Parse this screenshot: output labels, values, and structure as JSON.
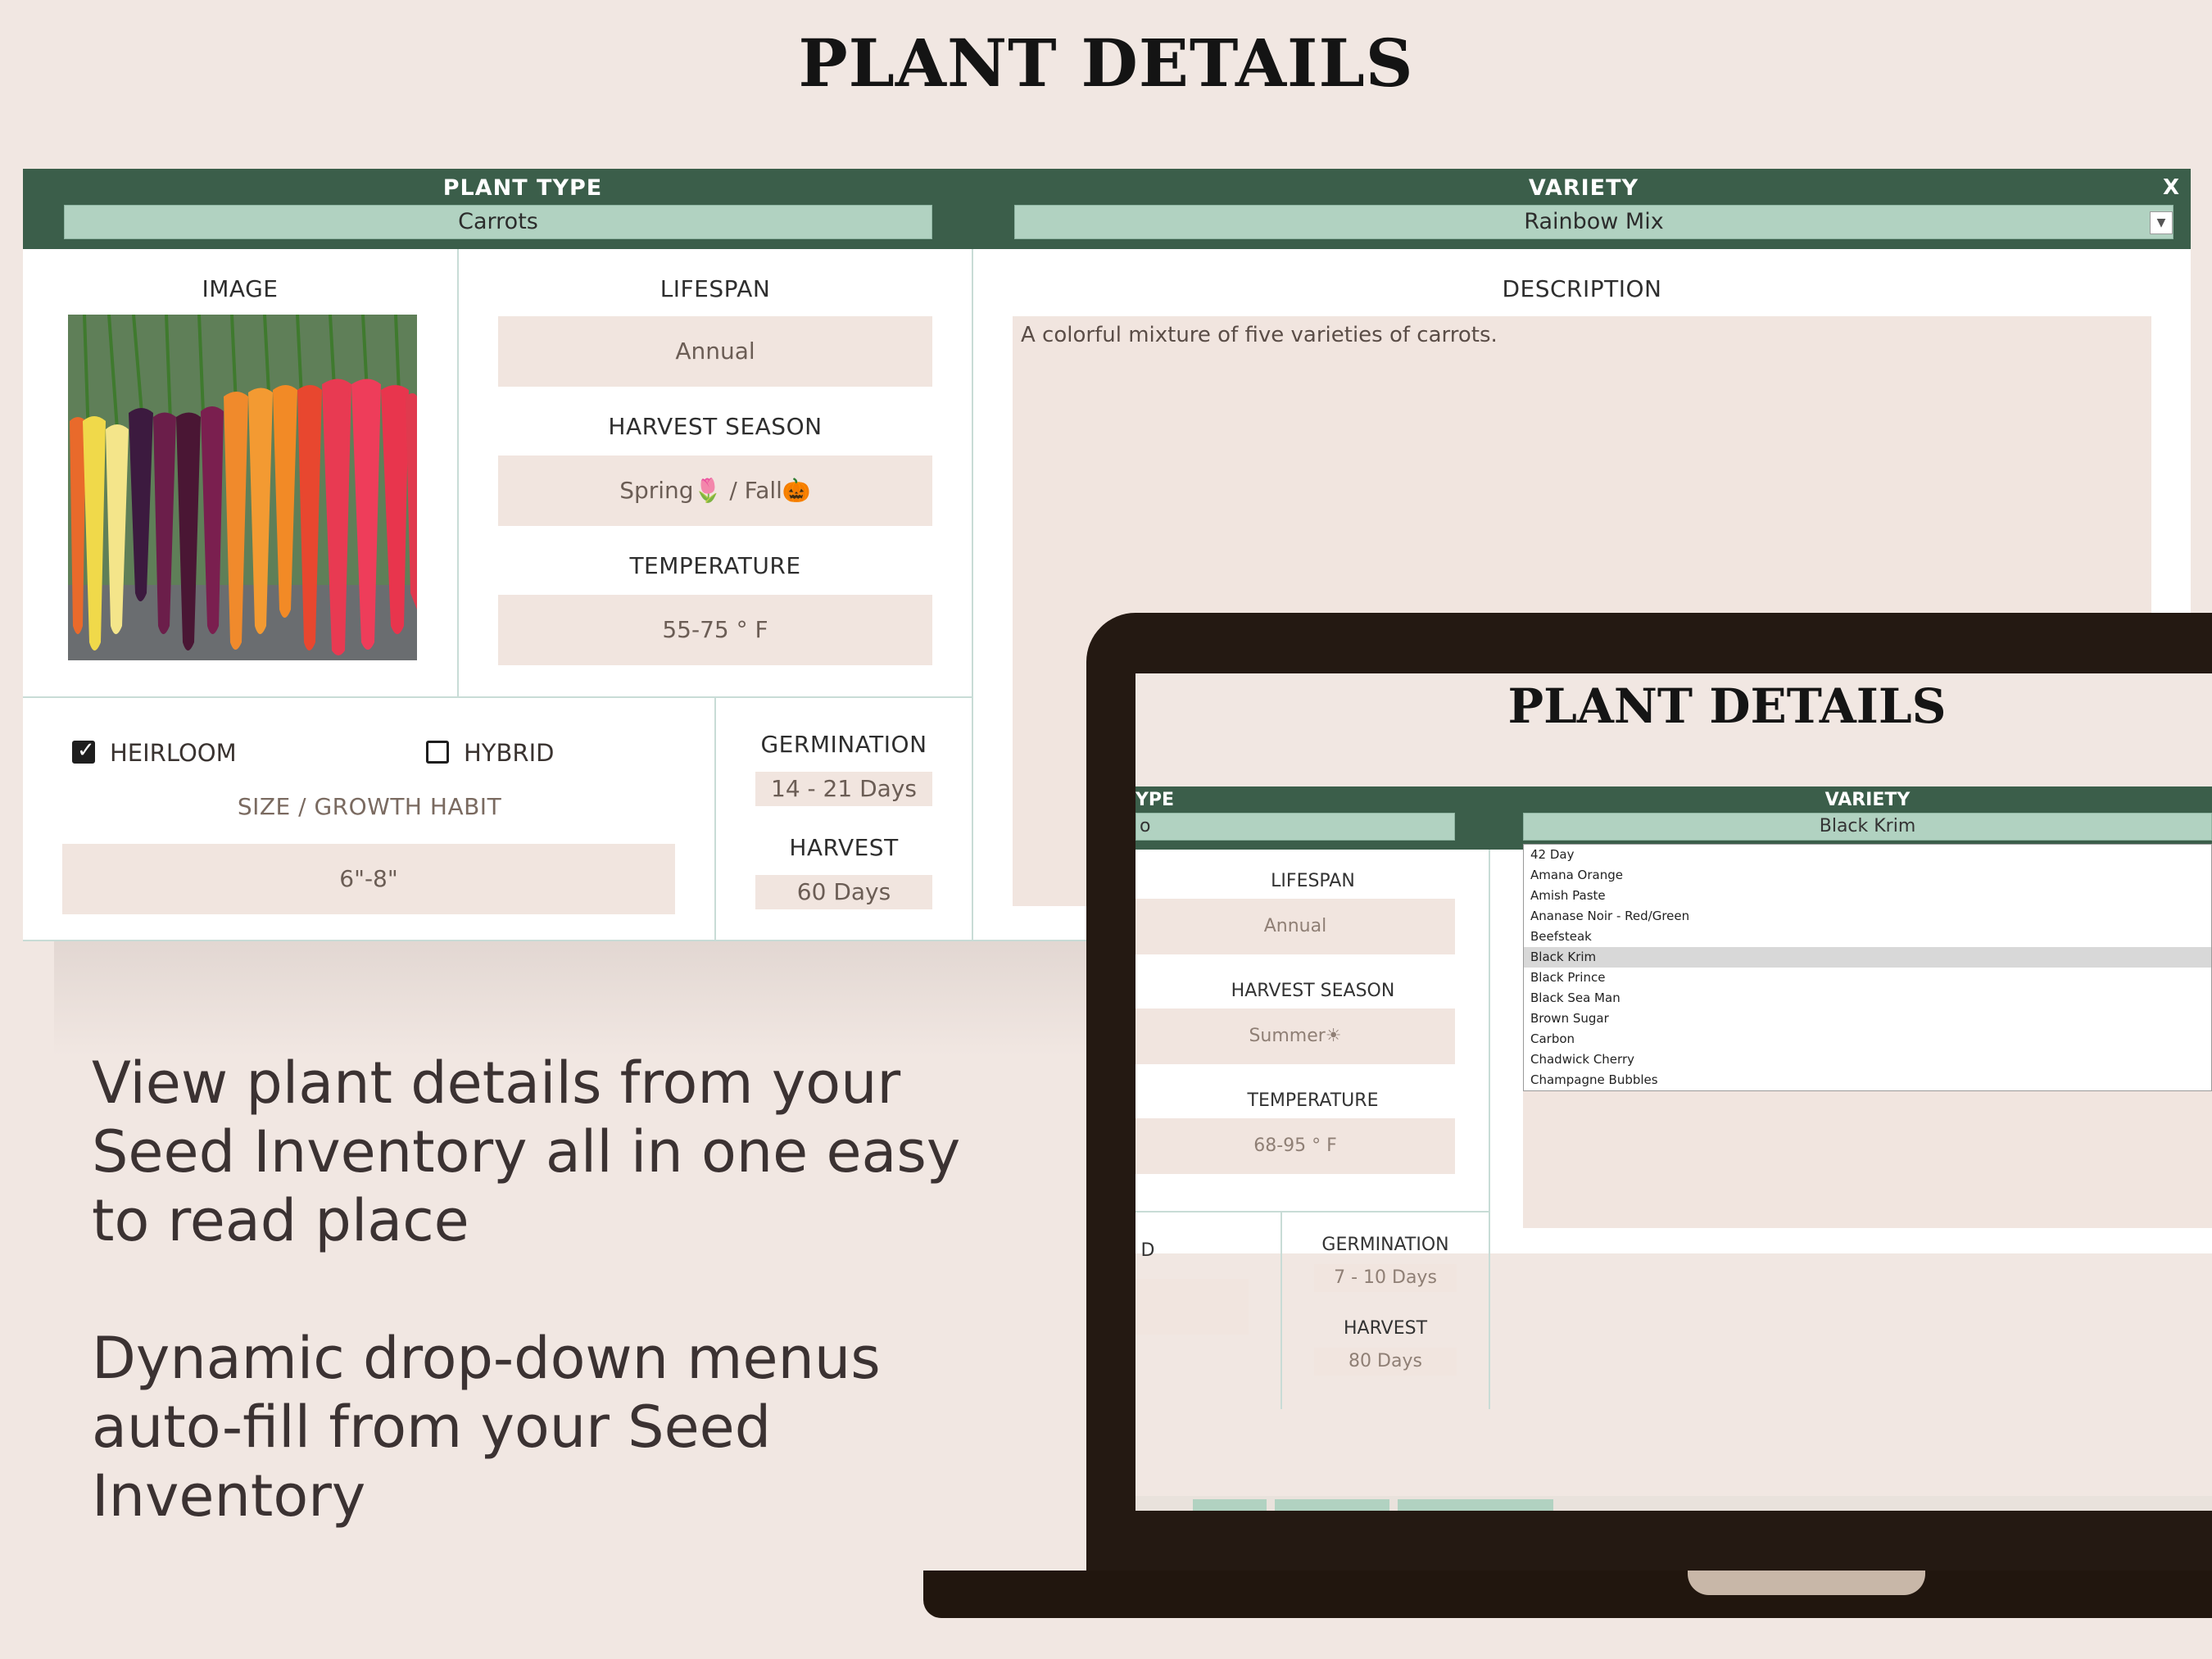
{
  "page_title": "PLANT DETAILS",
  "form": {
    "plant_type_label": "PLANT TYPE",
    "plant_type_value": "Carrots",
    "variety_label": "VARIETY",
    "variety_value": "Rainbow Mix",
    "close_label": "X",
    "image_label": "IMAGE",
    "lifespan_label": "LIFESPAN",
    "lifespan_value": "Annual",
    "harvest_season_label": "HARVEST SEASON",
    "harvest_season_value": "Spring🌷 / Fall🎃",
    "temperature_label": "TEMPERATURE",
    "temperature_value": "55-75 ° F",
    "description_label": "DESCRIPTION",
    "description_value": "A colorful mixture of five varieties of carrots.",
    "heirloom_label": "HEIRLOOM",
    "heirloom_checked": true,
    "hybrid_label": "HYBRID",
    "hybrid_checked": false,
    "size_label": "SIZE / GROWTH HABIT",
    "size_value": "6\"-8\"",
    "germination_label": "GERMINATION",
    "germination_value": "14 - 21 Days",
    "harvest_label": "HARVEST",
    "harvest_value": "60 Days"
  },
  "promo": {
    "line1": "View plant details from your Seed Inventory all in one easy to read place",
    "line2": "Dynamic drop-down menus auto-fill from your Seed Inventory"
  },
  "laptop_screen": {
    "title": "PLANT DETAILS",
    "type_label_partial": "YPE",
    "type_value_partial": "o",
    "variety_label": "VARIETY",
    "variety_value": "Black Krim",
    "lifespan_label": "LIFESPAN",
    "lifespan_value": "Annual",
    "harvest_season_label": "HARVEST SEASON",
    "harvest_season_value": "Summer☀",
    "temperature_label": "TEMPERATURE",
    "temperature_value": "68-95 ° F",
    "partial_label": "D",
    "germination_label": "GERMINATION",
    "germination_value": "7 - 10 Days",
    "harvest_label": "HARVEST",
    "harvest_value": "80 Days",
    "dropdown_options": [
      "42 Day",
      "Amana Orange",
      "Amish Paste",
      "Ananase Noir - Red/Green",
      "Beefsteak",
      "Black Krim",
      "Black Prince",
      "Black Sea Man",
      "Brown Sugar",
      "Carbon",
      "Chadwick Cherry",
      "Champagne Bubbles"
    ],
    "dropdown_selected": "Black Krim"
  },
  "colors": {
    "header_green": "#3b5e4a",
    "field_green": "#b1d2c1",
    "value_pink": "#f1e5df",
    "background": "#f1e7e2"
  },
  "icons": [
    "close-icon",
    "dropdown-arrow-icon",
    "checkbox-checked-icon",
    "checkbox-empty-icon"
  ]
}
